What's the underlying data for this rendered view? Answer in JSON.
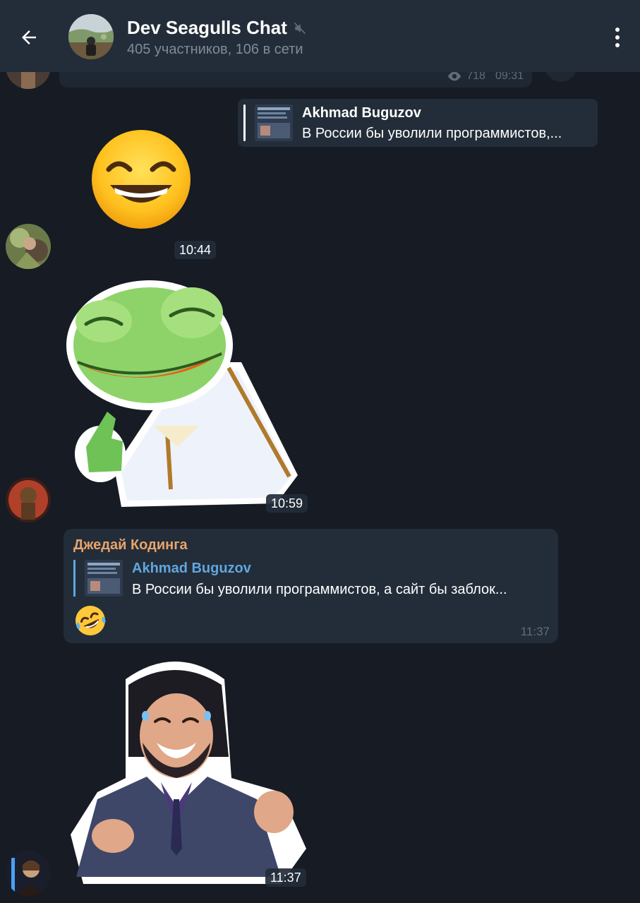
{
  "header": {
    "title": "Dev Seagulls Chat",
    "subtitle": "405 участников, 106 в сети",
    "back_icon": "arrow-left-icon",
    "mute_icon": "muted-speaker-icon",
    "menu_icon": "more-vert-icon"
  },
  "previous_message": {
    "views": "718",
    "time": "09:31",
    "views_icon": "eye-icon"
  },
  "messages": [
    {
      "reply": {
        "name": "Akhmad Buguzov",
        "text": "В России бы уволили программистов,..."
      },
      "sticker": "grinning-face-emoji",
      "time": "10:44"
    },
    {
      "sticker": "frog-thumbs-up-sticker",
      "time": "10:59"
    },
    {
      "sender": "Джедай Кодинга",
      "reply": {
        "name": "Akhmad Buguzov",
        "text": "В России бы уволили программистов, а сайт бы заблок..."
      },
      "emoji": "rolling-laughing-emoji",
      "time": "11:37"
    },
    {
      "sticker": "laughing-man-shrug-sticker",
      "time": "11:37"
    }
  ],
  "colors": {
    "background": "#161b24",
    "header": "#232d39",
    "bubble": "#232d39",
    "sender_name": "#e8a46a",
    "reply_accent": "#60a6e0",
    "muted_text": "#7d8b99"
  }
}
